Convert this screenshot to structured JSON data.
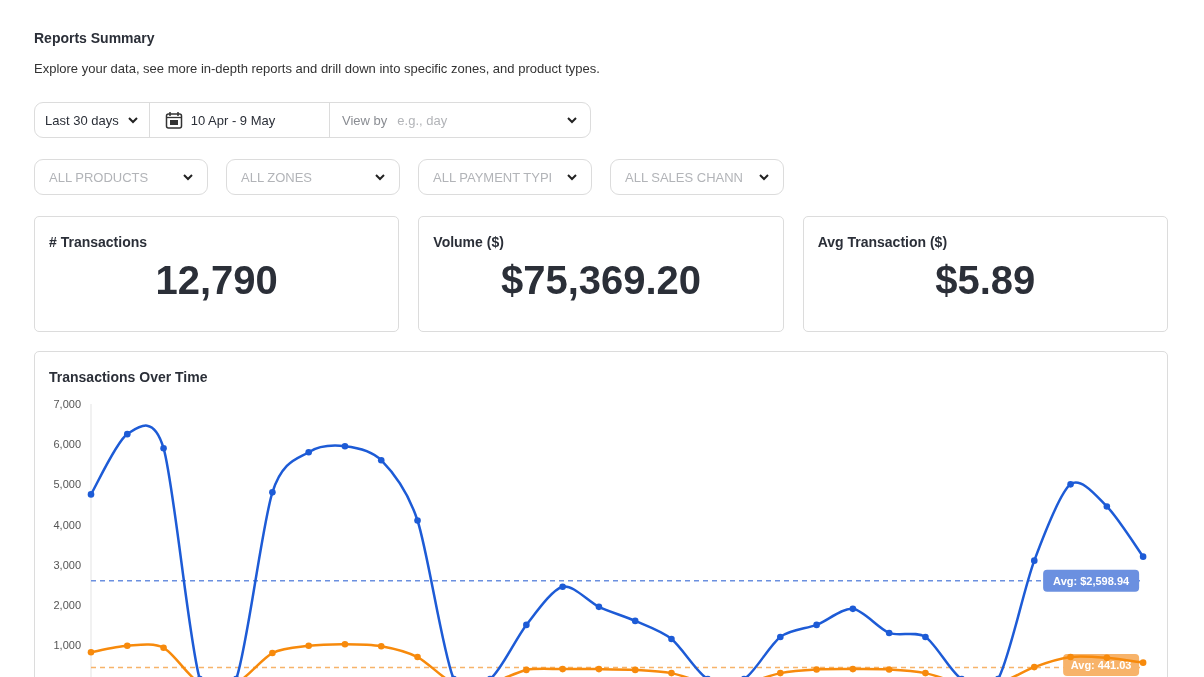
{
  "header": {
    "title": "Reports Summary",
    "description": "Explore your data, see more in-depth reports and drill down into specific zones, and product types."
  },
  "date_controls": {
    "range": "Last 30 days",
    "dates": "10 Apr - 9 May",
    "view_by_label": "View by",
    "view_by_placeholder": "e.g., day"
  },
  "filters": [
    {
      "placeholder": "ALL PRODUCTS"
    },
    {
      "placeholder": "ALL ZONES"
    },
    {
      "placeholder": "ALL PAYMENT TYPI"
    },
    {
      "placeholder": "ALL SALES CHANN"
    }
  ],
  "stats": [
    {
      "label": "# Transactions",
      "value": "12,790"
    },
    {
      "label": "Volume ($)",
      "value": "$75,369.20"
    },
    {
      "label": "Avg Transaction ($)",
      "value": "$5.89"
    }
  ],
  "chart": {
    "chart_data": {
      "type": "line",
      "title": "Transactions Over Time",
      "categories": [
        null,
        null,
        null,
        null,
        null,
        null,
        null,
        null,
        null,
        null,
        null,
        null,
        null,
        null,
        null,
        null,
        null,
        null,
        null,
        null,
        null,
        null,
        null,
        null,
        null,
        null,
        null,
        null,
        null,
        null
      ],
      "ylim": [
        0,
        7000
      ],
      "yticks": [
        {
          "value": 1000,
          "label": "1,000"
        },
        {
          "value": 2000,
          "label": "2,000"
        },
        {
          "value": 3000,
          "label": "3,000"
        },
        {
          "value": 4000,
          "label": "4,000"
        },
        {
          "value": 5000,
          "label": "5,000"
        },
        {
          "value": 6000,
          "label": "6,000"
        },
        {
          "value": 7000,
          "label": "7,000"
        }
      ],
      "series": [
        {
          "color": "#1d5bd6",
          "marker": true,
          "values": [
            4750,
            6250,
            5900,
            150,
            150,
            4800,
            5800,
            5950,
            5600,
            4100,
            150,
            150,
            1500,
            2450,
            1950,
            1600,
            1150,
            150,
            150,
            1200,
            1500,
            1900,
            1300,
            1200,
            150,
            150,
            3100,
            5000,
            4450,
            3200
          ]
        },
        {
          "color": "#f78a0c",
          "marker": true,
          "values": [
            820,
            980,
            930,
            50,
            50,
            800,
            980,
            1020,
            970,
            700,
            50,
            50,
            380,
            400,
            400,
            380,
            300,
            50,
            50,
            300,
            390,
            400,
            390,
            300,
            50,
            50,
            450,
            700,
            680,
            560
          ]
        }
      ],
      "ref_lines": [
        {
          "axis": "y",
          "value": 2598.94,
          "label": "Avg: $2,598.94",
          "color": "#6b90e0"
        },
        {
          "axis": "y",
          "value": 441.03,
          "label": "Avg: 441.03",
          "color": "#f7b36a"
        }
      ]
    }
  }
}
